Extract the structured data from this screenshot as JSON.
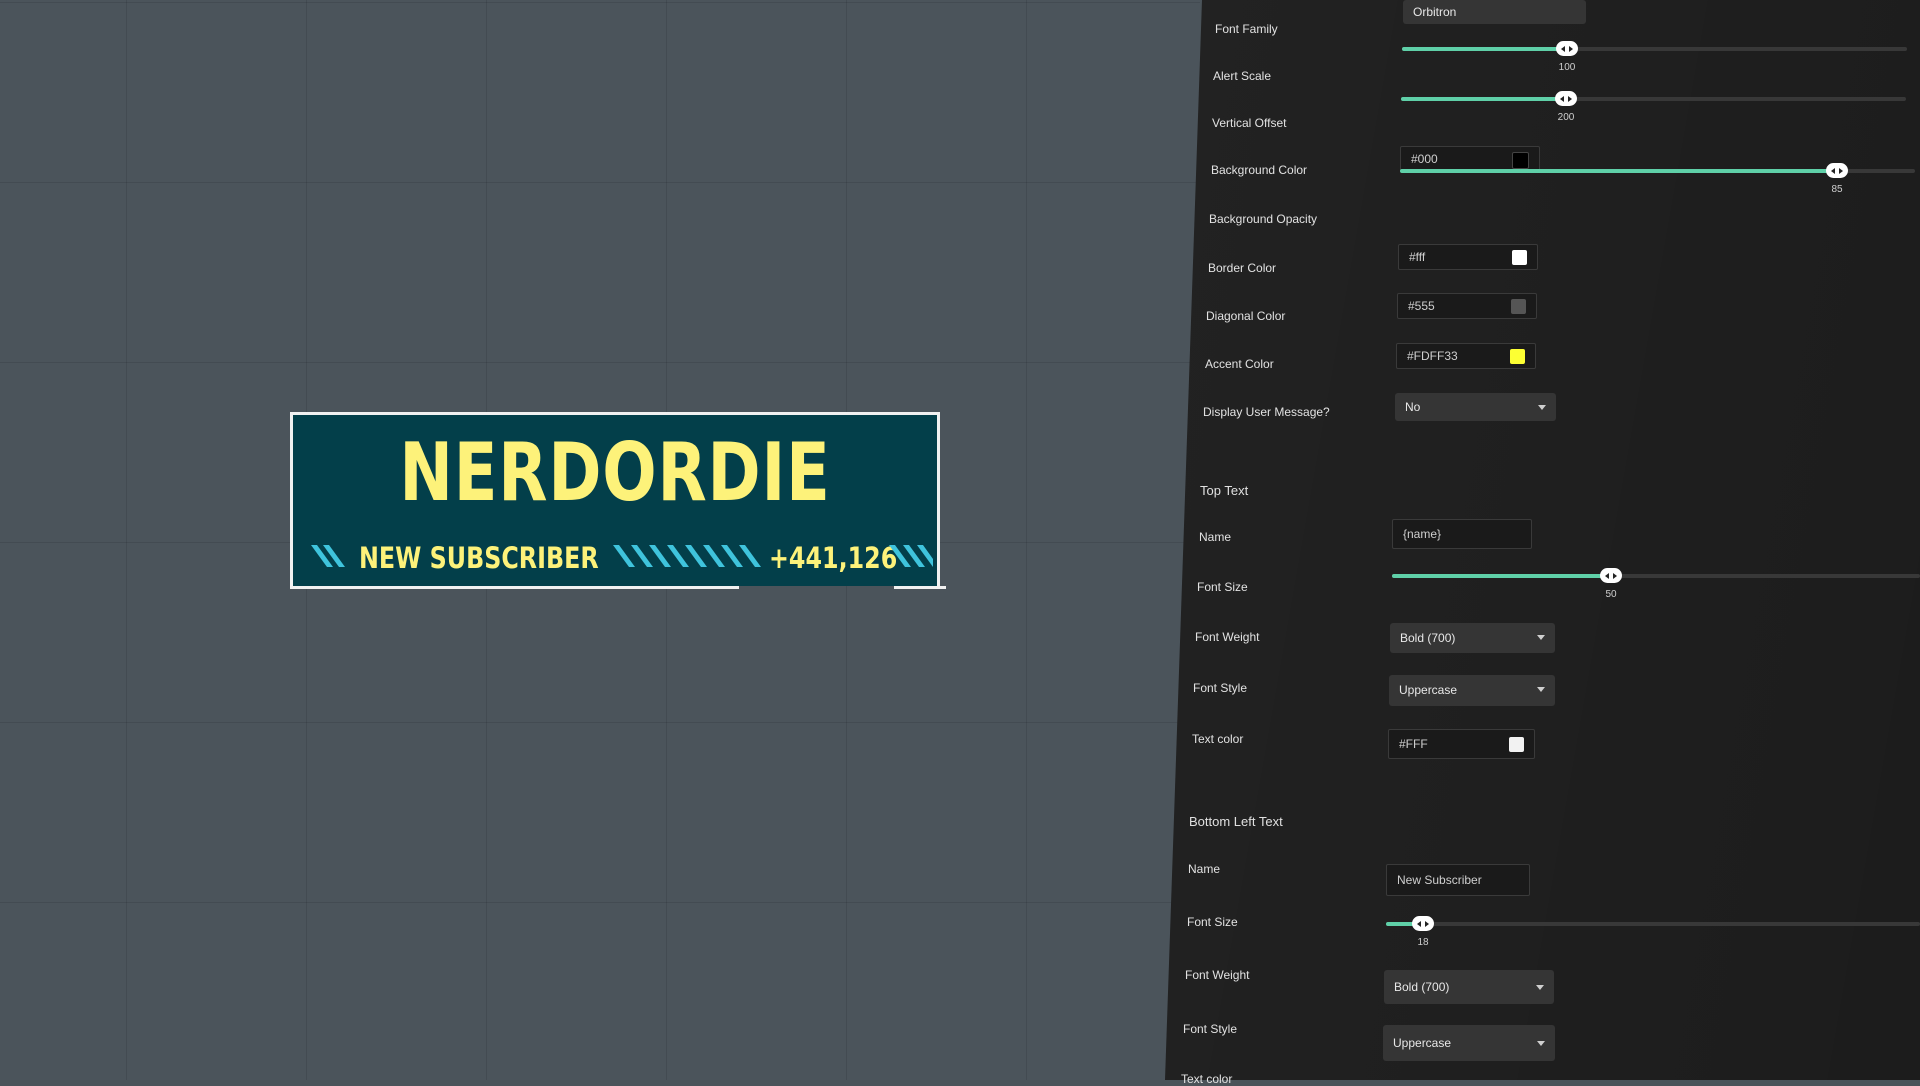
{
  "alert": {
    "title": "NERDORDIE",
    "label": "NEW SUBSCRIBER",
    "count": "+441,126",
    "colors": {
      "background": "#033f4a",
      "accent": "#fdf27a",
      "border": "#f1f1f1",
      "stripes": "#3fc4dd"
    }
  },
  "settings": {
    "font_family": {
      "label": "Font Family",
      "value": "Orbitron"
    },
    "alert_scale": {
      "label": "Alert Scale",
      "value": "100",
      "fraction": 0.33
    },
    "vertical_offset": {
      "label": "Vertical Offset",
      "value": "200",
      "fraction": 0.33
    },
    "background_color": {
      "label": "Background Color",
      "value": "#000",
      "swatch": "#000000"
    },
    "background_opacity": {
      "label": "Background Opacity",
      "value": "85",
      "fraction": 0.85
    },
    "border_color": {
      "label": "Border Color",
      "value": "#fff",
      "swatch": "#ffffff"
    },
    "diagonal_color": {
      "label": "Diagonal Color",
      "value": "#555",
      "swatch": "#555555"
    },
    "accent_color": {
      "label": "Accent Color",
      "value": "#FDFF33",
      "swatch": "#FDFF33"
    },
    "display_user_message": {
      "label": "Display User Message?",
      "value": "No"
    },
    "top_text": {
      "section": "Top Text",
      "name": {
        "label": "Name",
        "value": "{name}"
      },
      "font_size": {
        "label": "Font Size",
        "value": "50",
        "fraction": 0.42
      },
      "font_weight": {
        "label": "Font Weight",
        "value": "Bold (700)"
      },
      "font_style": {
        "label": "Font Style",
        "value": "Uppercase"
      },
      "text_color": {
        "label": "Text color",
        "value": "#FFF",
        "swatch": "#f2f2f2"
      }
    },
    "bottom_left_text": {
      "section": "Bottom Left Text",
      "name": {
        "label": "Name",
        "value": "New Subscriber"
      },
      "font_size": {
        "label": "Font Size",
        "value": "18",
        "fraction": 0.07
      },
      "font_weight": {
        "label": "Font Weight",
        "value": "Bold (700)"
      },
      "font_style": {
        "label": "Font Style",
        "value": "Uppercase"
      },
      "next_label": "Text color"
    }
  }
}
